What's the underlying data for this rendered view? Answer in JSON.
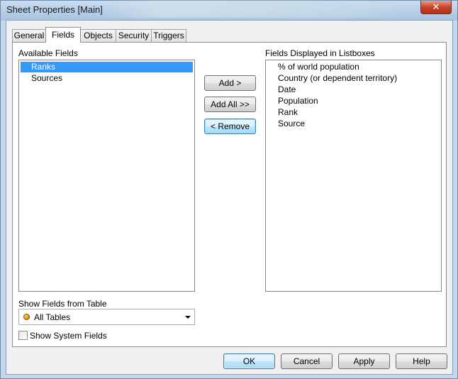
{
  "window": {
    "title": "Sheet Properties [Main]",
    "close_glyph": "✕"
  },
  "tabs": [
    "General",
    "Fields",
    "Objects",
    "Security",
    "Triggers"
  ],
  "active_tab": "Fields",
  "available_fields": {
    "label": "Available Fields",
    "items": [
      "Ranks",
      "Sources"
    ],
    "selected": "Ranks"
  },
  "displayed_fields": {
    "label": "Fields Displayed in Listboxes",
    "items": [
      "% of world population",
      "Country (or dependent territory)",
      "Date",
      "Population",
      "Rank",
      "Source"
    ]
  },
  "buttons": {
    "add": "Add >",
    "add_all": "Add All >>",
    "remove": "< Remove"
  },
  "show_fields_from_table": {
    "label": "Show Fields from Table",
    "value": "All Tables"
  },
  "show_system_fields": {
    "label": "Show System Fields",
    "checked": false
  },
  "footer": {
    "ok": "OK",
    "cancel": "Cancel",
    "apply": "Apply",
    "help": "Help"
  }
}
